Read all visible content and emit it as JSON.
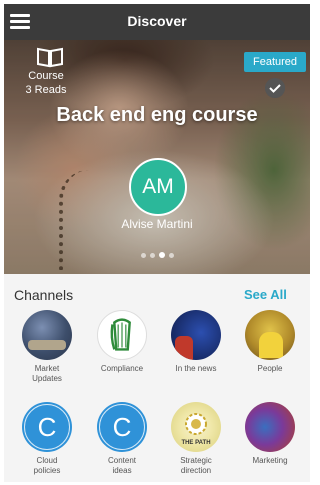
{
  "app": {
    "title": "Discover"
  },
  "hero": {
    "type": "Course",
    "reads": "3 Reads",
    "badge": "Featured",
    "title": "Back end eng course",
    "avatar_initials": "AM",
    "author": "Alvise Martini",
    "carousel_total": 4,
    "carousel_active": 3
  },
  "channels": {
    "title": "Channels",
    "see_all": "See All",
    "items": [
      {
        "line1": "Market",
        "line2": "Updates",
        "icon": "market-updates-image"
      },
      {
        "line1": "Compliance",
        "line2": "",
        "icon": "harp-logo-icon"
      },
      {
        "line1": "In the news",
        "line2": "",
        "icon": "news-image"
      },
      {
        "line1": "People",
        "line2": "",
        "icon": "people-image"
      },
      {
        "line1": "Cloud",
        "line2": "policies",
        "initial": "C",
        "icon": "letter-c-icon"
      },
      {
        "line1": "Content",
        "line2": "ideas",
        "initial": "C",
        "icon": "letter-c-icon"
      },
      {
        "line1": "Strategic",
        "line2": "direction",
        "logo_text": "THE PATH",
        "icon": "the-path-logo"
      },
      {
        "line1": "Marketing",
        "line2": "",
        "icon": "marketing-image"
      }
    ]
  },
  "colors": {
    "topbar": "#3b3b3b",
    "accent": "#2aa9c9",
    "avatar": "#2bb89a",
    "channel_blue": "#2f92d8",
    "compliance_green": "#2e8b3a"
  }
}
